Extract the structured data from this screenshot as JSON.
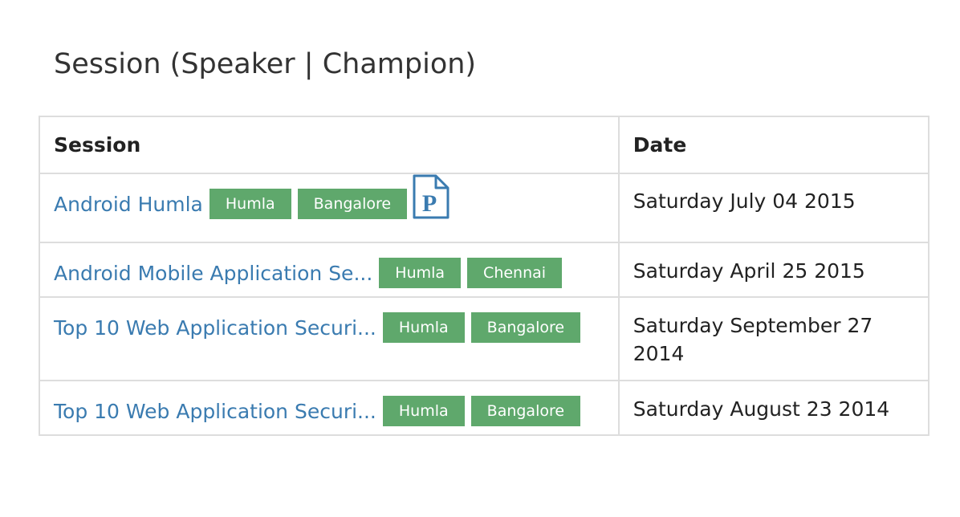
{
  "page": {
    "heading": "Session (Speaker | Champion)"
  },
  "table": {
    "headers": {
      "session": "Session",
      "date": "Date"
    },
    "rows": [
      {
        "title": "Android Humla",
        "tags": [
          "Humla",
          "Bangalore"
        ],
        "has_pdf": true,
        "pdf_icon": "pdf-presentation-icon",
        "date": "Saturday July 04 2015"
      },
      {
        "title": "Android Mobile Application Se...",
        "tags": [
          "Humla",
          "Chennai"
        ],
        "has_pdf": false,
        "date": "Saturday April 25 2015"
      },
      {
        "title": "Top 10 Web Application Securi...",
        "tags": [
          "Humla",
          "Bangalore"
        ],
        "has_pdf": false,
        "date": "Saturday September 27 2014"
      },
      {
        "title": "Top 10 Web Application Securi...",
        "tags": [
          "Humla",
          "Bangalore"
        ],
        "has_pdf": false,
        "date": "Saturday August 23 2014"
      }
    ]
  },
  "colors": {
    "link": "#3a7bb0",
    "tag_bg": "#5fa86c",
    "tag_text": "#ffffff",
    "border": "#dddddd",
    "icon": "#3a7bb0"
  }
}
